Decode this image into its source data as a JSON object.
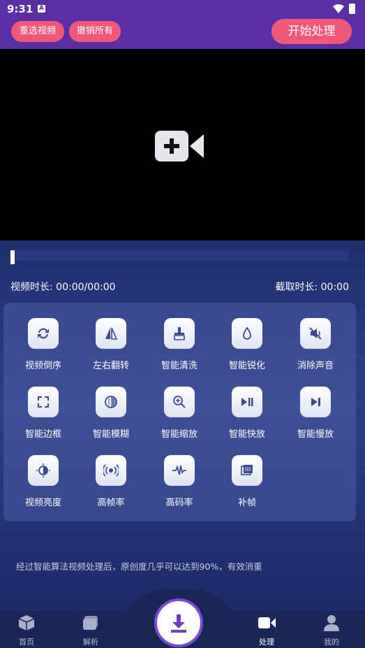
{
  "status": {
    "time": "9:31",
    "notif_letter": "A"
  },
  "topbar": {
    "reselect_label": "重选视频",
    "undo_label": "撤销所有",
    "start_label": "开始处理"
  },
  "info": {
    "duration": "视频时长: 00:00/00:00",
    "cut": "截取时长: 00:00"
  },
  "tools": [
    {
      "label": "视频倒序",
      "icon": "reverse-icon"
    },
    {
      "label": "左右翻转",
      "icon": "flip-icon"
    },
    {
      "label": "智能清洗",
      "icon": "broom-icon"
    },
    {
      "label": "智能锐化",
      "icon": "drop-icon"
    },
    {
      "label": "消除声音",
      "icon": "mute-icon"
    },
    {
      "label": "智能边框",
      "icon": "frame-icon"
    },
    {
      "label": "智能模糊",
      "icon": "blur-icon"
    },
    {
      "label": "智能缩放",
      "icon": "zoom-icon"
    },
    {
      "label": "智能快放",
      "icon": "fast-play-icon"
    },
    {
      "label": "智能慢放",
      "icon": "slow-play-icon"
    },
    {
      "label": "视频亮度",
      "icon": "brightness-icon"
    },
    {
      "label": "高帧率",
      "icon": "broadcast-icon"
    },
    {
      "label": "高码率",
      "icon": "waveform-icon"
    },
    {
      "label": "补帧",
      "icon": "film-icon"
    }
  ],
  "note": "经过智能算法视频处理后，原创度几乎可以达到90%，有效消重",
  "tabs": [
    {
      "label": "首页",
      "icon": "cube-icon"
    },
    {
      "label": "解析",
      "icon": "cards-icon"
    },
    {
      "label": "处理",
      "icon": "video-camera-icon",
      "active": true
    },
    {
      "label": "我的",
      "icon": "person-icon"
    }
  ],
  "colors": {
    "accent": "#f0587a",
    "header": "#5b2fa4",
    "icon": "#3b4a8e"
  }
}
